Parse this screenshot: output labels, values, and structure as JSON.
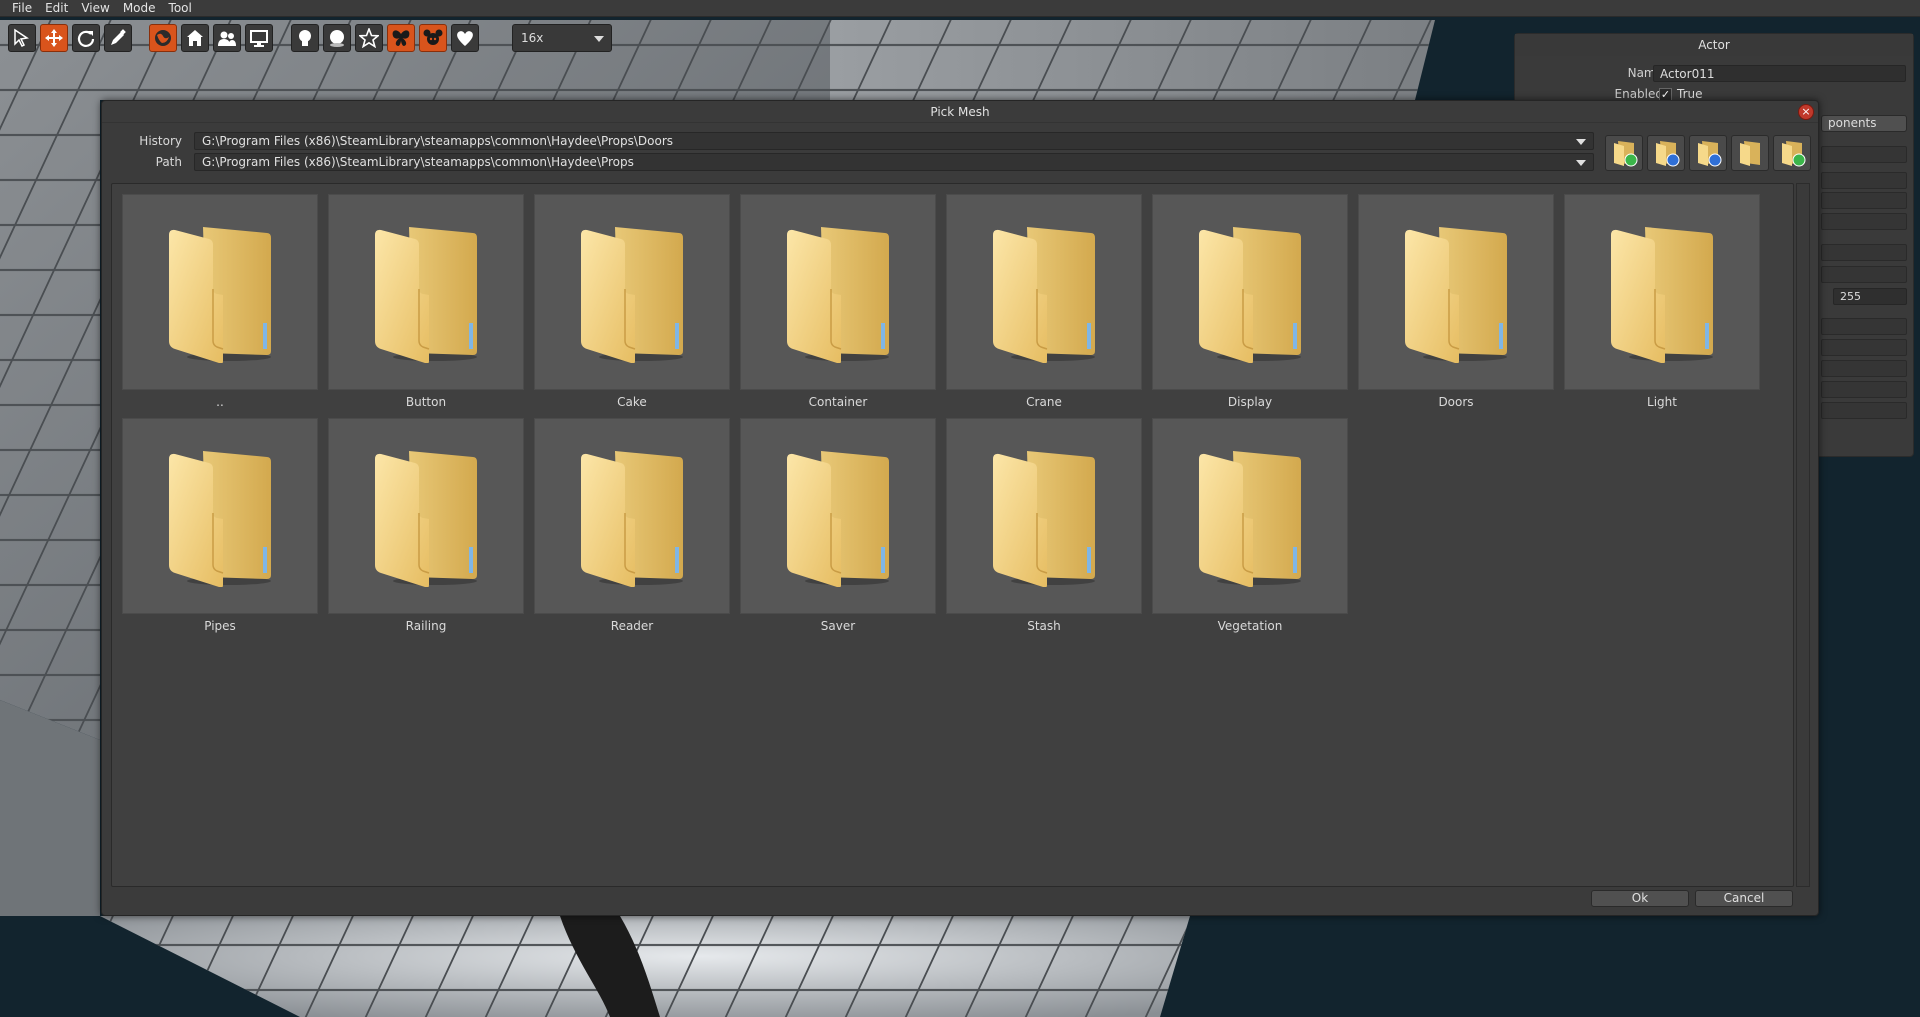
{
  "menu": [
    "File",
    "Edit",
    "View",
    "Mode",
    "Tool"
  ],
  "toolbar": {
    "tools": [
      {
        "icon": "select-arrow-icon",
        "active": false
      },
      {
        "icon": "move-icon",
        "active": true
      },
      {
        "icon": "rotate-icon",
        "active": false
      },
      {
        "icon": "edit-tool-icon",
        "active": false
      }
    ],
    "modes": [
      {
        "icon": "globe-icon",
        "active": true
      },
      {
        "icon": "house-icon",
        "active": false
      },
      {
        "icon": "people-icon",
        "active": false
      },
      {
        "icon": "monitor-icon",
        "active": false
      }
    ],
    "display": [
      {
        "icon": "lightbulb-icon",
        "active": false
      },
      {
        "icon": "sphere-icon",
        "active": false
      },
      {
        "icon": "star-icon",
        "active": false
      },
      {
        "icon": "butterfly-icon",
        "active": true
      },
      {
        "icon": "character-head-icon",
        "active": true
      },
      {
        "icon": "heart-icon",
        "active": false
      }
    ],
    "zoom": "16x"
  },
  "actor_panel": {
    "title": "Actor",
    "name_label": "Name",
    "name_value": "Actor011",
    "enabled_label": "Enabled",
    "enabled_value": "True",
    "components_label": "ponents",
    "value_255": "255"
  },
  "dialog": {
    "title": "Pick Mesh",
    "history_label": "History",
    "history_value": "G:\\Program Files (x86)\\SteamLibrary\\steamapps\\common\\Haydee\\Props\\Doors",
    "path_label": "Path",
    "path_value": "G:\\Program Files (x86)\\SteamLibrary\\steamapps\\common\\Haydee\\Props",
    "nav_buttons": [
      "folder-up-icon",
      "folder-back-icon",
      "folder-forward-icon",
      "folder-open-icon",
      "folder-new-icon"
    ],
    "folders": [
      "..",
      "Button",
      "Cake",
      "Container",
      "Crane",
      "Display",
      "Doors",
      "Light",
      "Pipes",
      "Railing",
      "Reader",
      "Saver",
      "Stash",
      "Vegetation"
    ],
    "ok_label": "Ok",
    "cancel_label": "Cancel"
  }
}
